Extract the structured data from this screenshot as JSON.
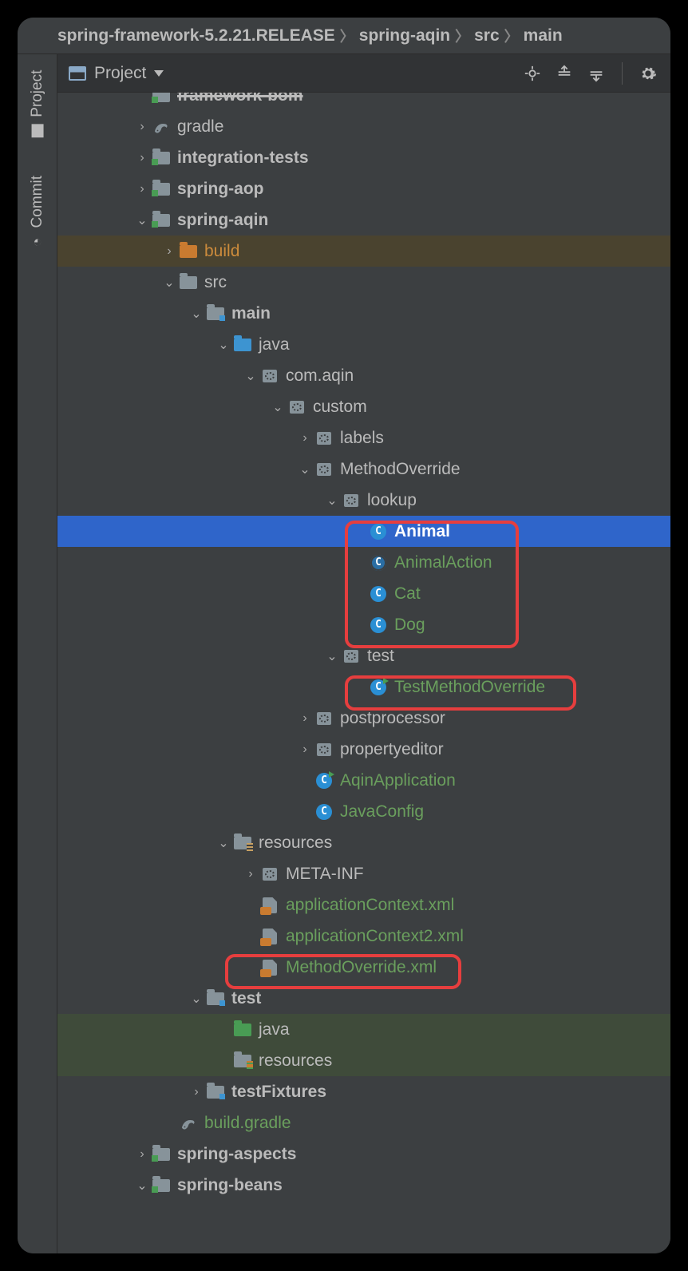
{
  "breadcrumb": [
    "spring-framework-5.2.21.RELEASE",
    "spring-aqin",
    "src",
    "main"
  ],
  "sidebar": {
    "tabs": [
      "Project",
      "Commit"
    ]
  },
  "toolbar": {
    "dropdown": "Project"
  },
  "tree": [
    {
      "indent": 2,
      "arrow": "none",
      "icon": "folder-mod",
      "label": "framework-bom",
      "style": "bold strike"
    },
    {
      "indent": 2,
      "arrow": "right",
      "icon": "gradle",
      "label": "gradle",
      "style": ""
    },
    {
      "indent": 2,
      "arrow": "right",
      "icon": "folder-mod",
      "label": "integration-tests",
      "style": "bold"
    },
    {
      "indent": 2,
      "arrow": "right",
      "icon": "folder-mod",
      "label": "spring-aop",
      "style": "bold"
    },
    {
      "indent": 2,
      "arrow": "down",
      "icon": "folder-mod",
      "label": "spring-aqin",
      "style": "bold"
    },
    {
      "indent": 3,
      "arrow": "right",
      "icon": "folder-orange",
      "label": "build",
      "style": "orange",
      "row": "build-row"
    },
    {
      "indent": 3,
      "arrow": "down",
      "icon": "folder",
      "label": "src",
      "style": ""
    },
    {
      "indent": 4,
      "arrow": "down",
      "icon": "folder-src",
      "label": "main",
      "style": "bold"
    },
    {
      "indent": 5,
      "arrow": "down",
      "icon": "folder-blue",
      "label": "java",
      "style": ""
    },
    {
      "indent": 6,
      "arrow": "down",
      "icon": "pkg",
      "label": "com.aqin",
      "style": ""
    },
    {
      "indent": 7,
      "arrow": "down",
      "icon": "pkg",
      "label": "custom",
      "style": ""
    },
    {
      "indent": 8,
      "arrow": "right",
      "icon": "pkg",
      "label": "labels",
      "style": ""
    },
    {
      "indent": 8,
      "arrow": "down",
      "icon": "pkg",
      "label": "MethodOverride",
      "style": ""
    },
    {
      "indent": 9,
      "arrow": "down",
      "icon": "pkg",
      "label": "lookup",
      "style": ""
    },
    {
      "indent": 10,
      "arrow": "none",
      "icon": "cls",
      "label": "Animal",
      "style": "bold",
      "row": "selected"
    },
    {
      "indent": 10,
      "arrow": "none",
      "icon": "iface",
      "label": "AnimalAction",
      "style": "green"
    },
    {
      "indent": 10,
      "arrow": "none",
      "icon": "cls",
      "label": "Cat",
      "style": "green"
    },
    {
      "indent": 10,
      "arrow": "none",
      "icon": "cls",
      "label": "Dog",
      "style": "green"
    },
    {
      "indent": 9,
      "arrow": "down",
      "icon": "pkg",
      "label": "test",
      "style": ""
    },
    {
      "indent": 10,
      "arrow": "none",
      "icon": "cls-run",
      "label": "TestMethodOverride",
      "style": "green"
    },
    {
      "indent": 8,
      "arrow": "right",
      "icon": "pkg",
      "label": "postprocessor",
      "style": ""
    },
    {
      "indent": 8,
      "arrow": "right",
      "icon": "pkg",
      "label": "propertyeditor",
      "style": ""
    },
    {
      "indent": 8,
      "arrow": "none",
      "icon": "cls-run",
      "label": "AqinApplication",
      "style": "green"
    },
    {
      "indent": 8,
      "arrow": "none",
      "icon": "cls",
      "label": "JavaConfig",
      "style": "green"
    },
    {
      "indent": 5,
      "arrow": "down",
      "icon": "folder-res",
      "label": "resources",
      "style": ""
    },
    {
      "indent": 6,
      "arrow": "right",
      "icon": "pkg",
      "label": "META-INF",
      "style": ""
    },
    {
      "indent": 6,
      "arrow": "none",
      "icon": "xml",
      "label": "applicationContext.xml",
      "style": "green"
    },
    {
      "indent": 6,
      "arrow": "none",
      "icon": "xml",
      "label": "applicationContext2.xml",
      "style": "green"
    },
    {
      "indent": 6,
      "arrow": "none",
      "icon": "xml",
      "label": "MethodOverride.xml",
      "style": "green"
    },
    {
      "indent": 4,
      "arrow": "down",
      "icon": "folder-src",
      "label": "test",
      "style": "bold"
    },
    {
      "indent": 5,
      "arrow": "none",
      "icon": "folder-green",
      "label": "java",
      "style": "",
      "row": "test-sub"
    },
    {
      "indent": 5,
      "arrow": "none",
      "icon": "folder-testres",
      "label": "resources",
      "style": "",
      "row": "test-sub"
    },
    {
      "indent": 4,
      "arrow": "right",
      "icon": "folder-src",
      "label": "testFixtures",
      "style": "bold"
    },
    {
      "indent": 3,
      "arrow": "none",
      "icon": "gradle",
      "label": "build.gradle",
      "style": "green"
    },
    {
      "indent": 2,
      "arrow": "right",
      "icon": "folder-mod",
      "label": "spring-aspects",
      "style": "bold"
    },
    {
      "indent": 2,
      "arrow": "down",
      "icon": "folder-mod",
      "label": "spring-beans",
      "style": "bold"
    }
  ]
}
